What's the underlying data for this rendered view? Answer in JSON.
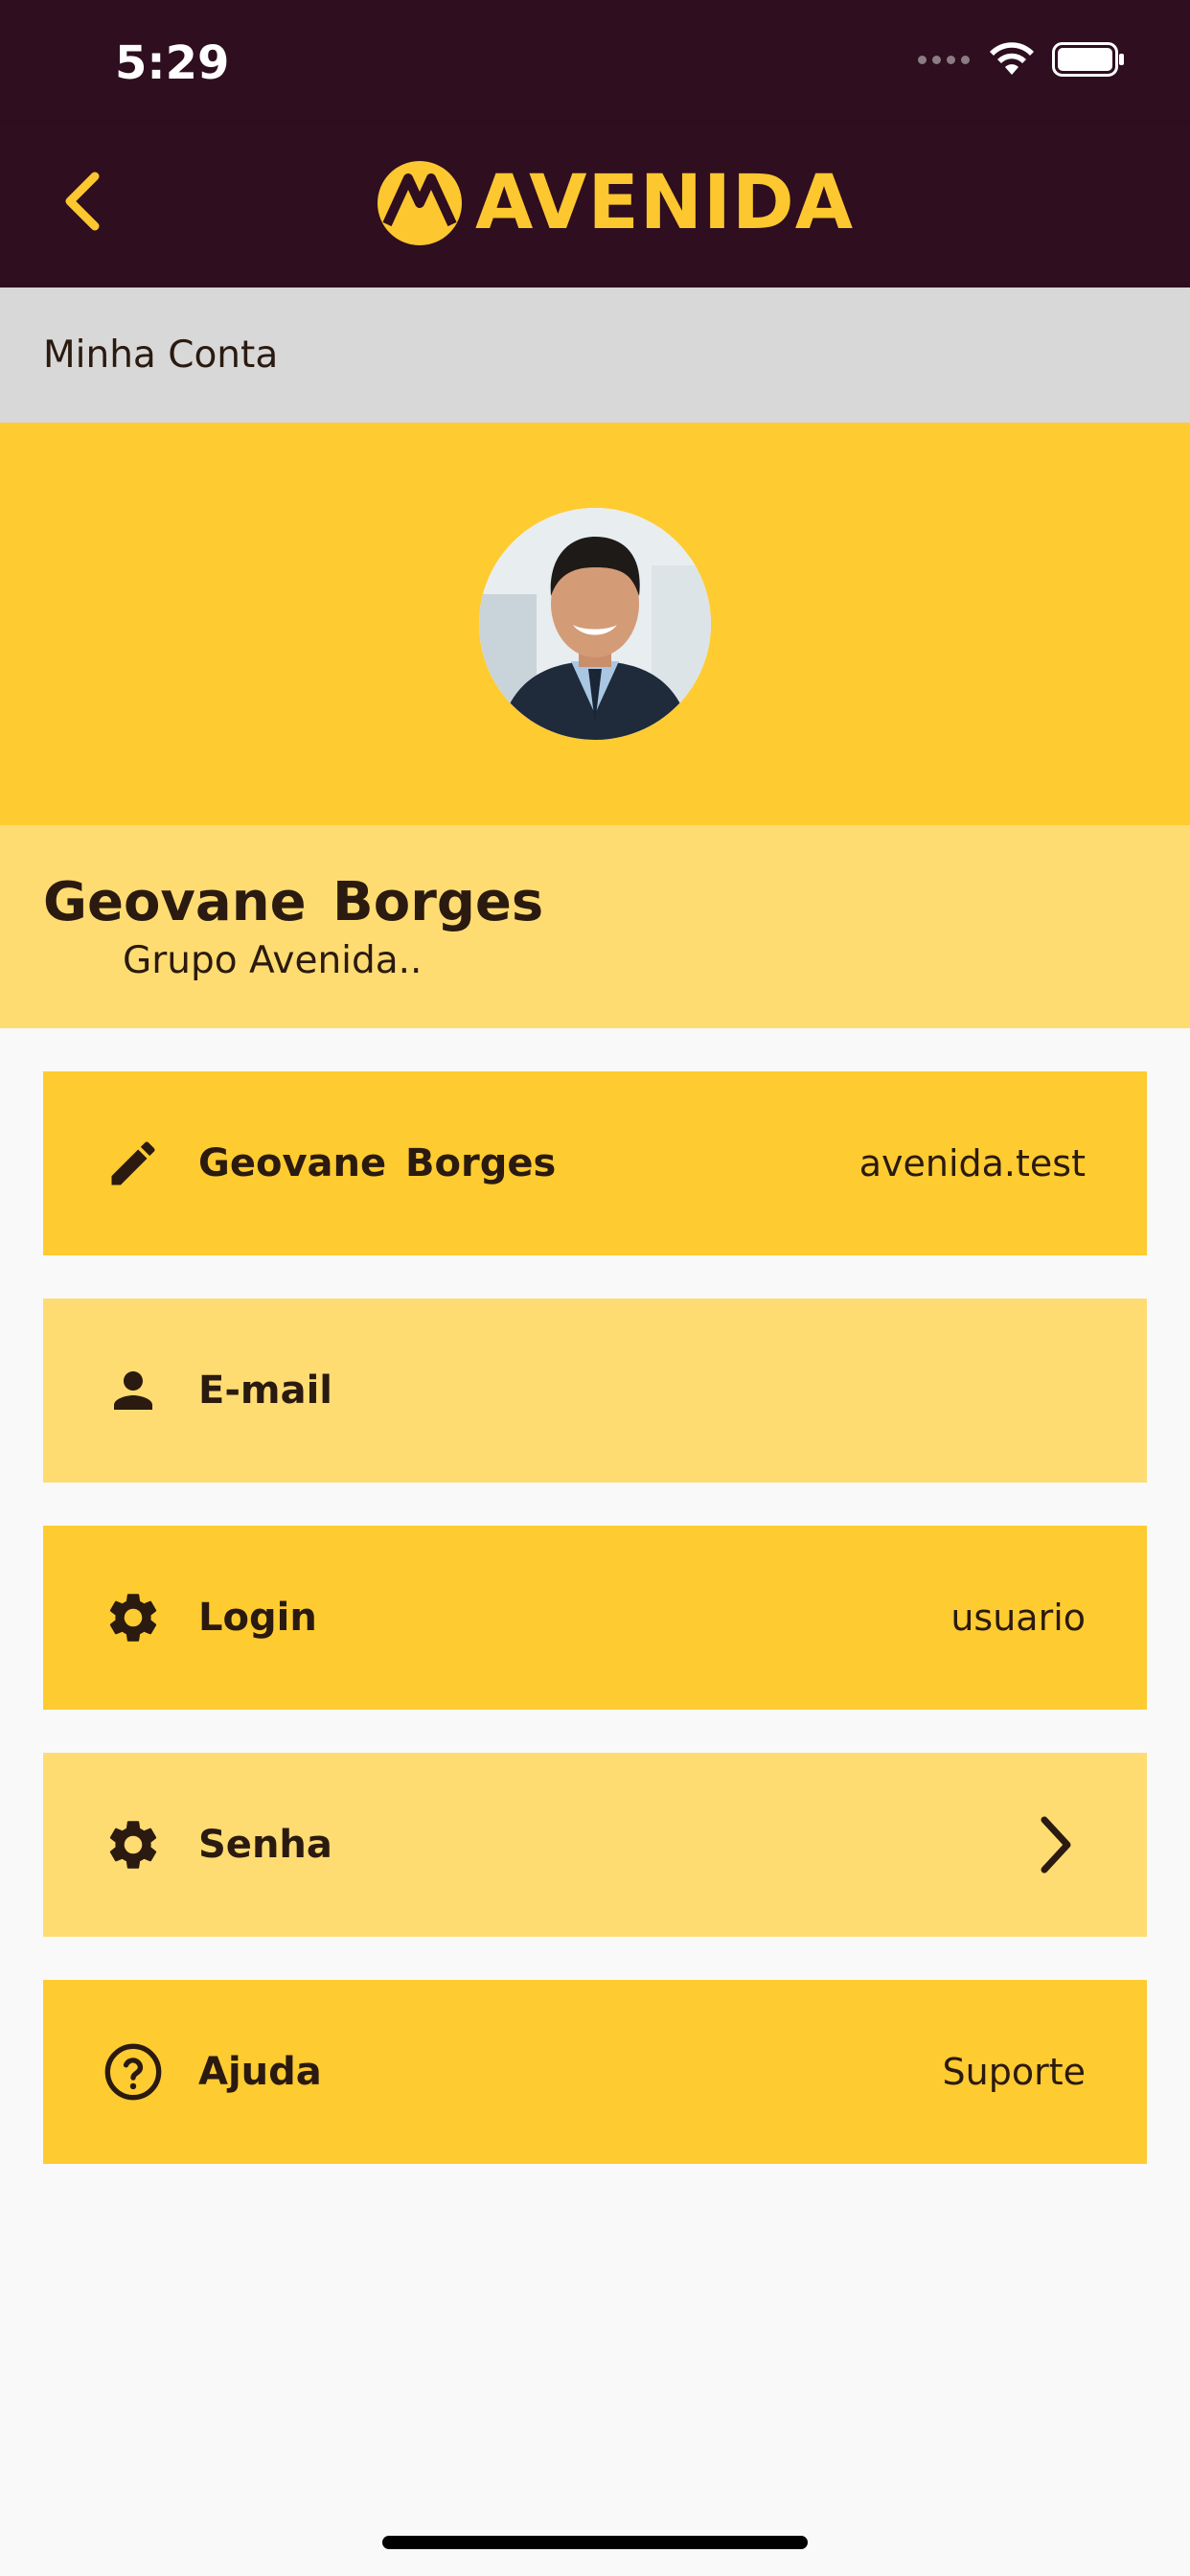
{
  "status_bar": {
    "time": "5:29",
    "icons": [
      "signal-icon",
      "wifi-icon",
      "battery-icon"
    ]
  },
  "header": {
    "back_icon": "chevron-left-icon",
    "brand_name": "AVENIDA",
    "brand_color": "#fcc72f",
    "background_color": "#2e0e1f"
  },
  "section": {
    "title": "Minha Conta"
  },
  "profile": {
    "name": "Geovane  Borges",
    "company": "Grupo Avenida.."
  },
  "menu": {
    "items": [
      {
        "icon": "pencil-icon",
        "label": "Geovane  Borges",
        "value": "avenida.test"
      },
      {
        "icon": "person-icon",
        "label": "E-mail",
        "value": ""
      },
      {
        "icon": "gear-icon",
        "label": "Login",
        "value": "usuario"
      },
      {
        "icon": "gear-icon",
        "label": "Senha",
        "value": "",
        "trailing_icon": "chevron-right-icon"
      },
      {
        "icon": "help-circle-icon",
        "label": "Ajuda",
        "value": "Suporte"
      }
    ]
  },
  "colors": {
    "yellow_dark": "#fecb31",
    "yellow_light": "#ffdc72",
    "section_gray": "#d8d8d8",
    "text": "#2a1a10"
  }
}
